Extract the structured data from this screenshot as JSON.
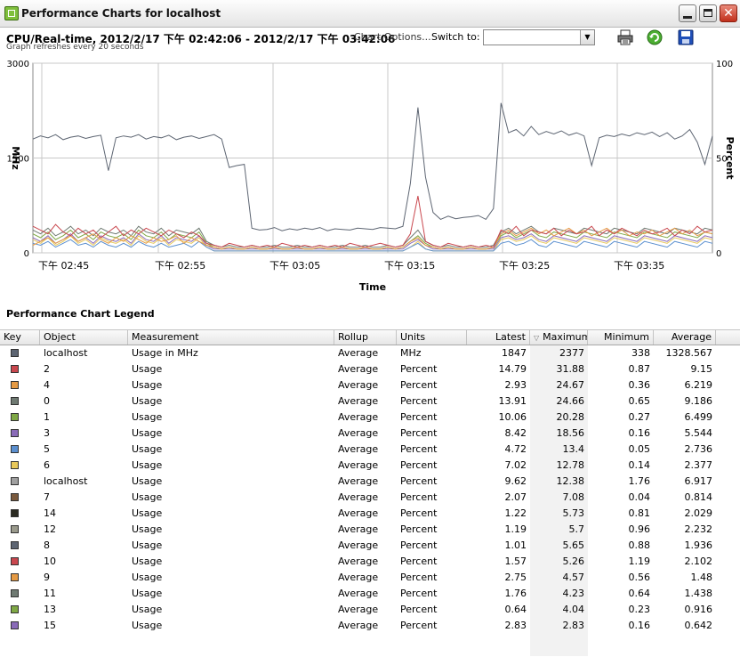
{
  "window": {
    "title": "Performance Charts for localhost"
  },
  "toolbar": {
    "chart_title": "CPU/Real-time, 2012/2/17 下午 02:42:06 - 2012/2/17 下午 03:42:06",
    "chart_options": "Chart Options...",
    "switch_label": "Switch to:",
    "switch_value": "",
    "refresh_note": "Graph refreshes every 20 seconds"
  },
  "chart_data": {
    "type": "line",
    "xlabel": "Time",
    "ylabel_left": "MHz",
    "ylabel_right": "Percent",
    "ylim_left": [
      0,
      3000
    ],
    "ylim_right": [
      0,
      100
    ],
    "yticks_left": [
      "3000",
      "1500",
      "0"
    ],
    "yticks_right": [
      "100",
      "50",
      "0"
    ],
    "xticks": [
      "下午 02:45",
      "下午 02:55",
      "下午 03:05",
      "下午 03:15",
      "下午 03:25",
      "下午 03:35"
    ],
    "grid": true,
    "series": [
      {
        "values": [
          1800,
          1850,
          1820,
          1870,
          1790,
          1830,
          1850,
          1810,
          1840,
          1860,
          1300,
          1820,
          1850,
          1830,
          1870,
          1800,
          1840,
          1820,
          1860,
          1790,
          1830,
          1850,
          1810,
          1840,
          1870,
          1800,
          1350,
          1380,
          1400,
          390,
          360,
          370,
          400,
          350,
          380,
          360,
          390,
          370,
          400,
          350,
          380,
          370,
          360,
          390,
          380,
          370,
          400,
          390,
          380,
          420,
          1100,
          2300,
          1200,
          640,
          530,
          580,
          540,
          560,
          570,
          590,
          530,
          700,
          2370,
          1900,
          1950,
          1850,
          2000,
          1870,
          1920,
          1880,
          1930,
          1860,
          1900,
          1850,
          1380,
          1820,
          1860,
          1840,
          1880,
          1850,
          1900,
          1870,
          1910,
          1840,
          1900,
          1800,
          1850,
          1950,
          1750,
          1400,
          1850
        ],
        "color": "#5d6572"
      },
      {
        "values": [
          14,
          12,
          10,
          15,
          11,
          9,
          13,
          10,
          12,
          8,
          11,
          14,
          9,
          12,
          10,
          13,
          11,
          9,
          12,
          10,
          8,
          11,
          9,
          5,
          4,
          3,
          5,
          4,
          3,
          4,
          3,
          4,
          3,
          5,
          4,
          3,
          4,
          3,
          4,
          3,
          4,
          3,
          5,
          4,
          3,
          4,
          5,
          4,
          3,
          4,
          10,
          30,
          6,
          4,
          3,
          5,
          4,
          3,
          4,
          3,
          4,
          3,
          12,
          10,
          14,
          9,
          12,
          11,
          10,
          13,
          9,
          12,
          10,
          11,
          14,
          9,
          12,
          10,
          13,
          11,
          9,
          12,
          10,
          11,
          13,
          9,
          12,
          10,
          14,
          11,
          12
        ],
        "color": "#c9474e"
      },
      {
        "values": [
          4,
          6,
          8,
          5,
          7,
          9,
          6,
          8,
          10,
          7,
          5,
          8,
          6,
          9,
          7,
          5,
          8,
          6,
          7,
          9,
          5,
          8,
          6,
          4,
          3,
          2,
          3,
          2,
          2,
          3,
          2,
          2,
          3,
          2,
          2,
          3,
          2,
          2,
          3,
          2,
          2,
          3,
          2,
          2,
          3,
          2,
          2,
          3,
          2,
          3,
          6,
          8,
          4,
          3,
          2,
          3,
          2,
          2,
          3,
          2,
          2,
          3,
          10,
          12,
          9,
          11,
          13,
          10,
          12,
          9,
          11,
          13,
          10,
          12,
          9,
          11,
          13,
          10,
          12,
          9,
          11,
          10,
          12,
          9,
          11,
          13,
          10,
          12,
          9,
          11,
          10
        ],
        "color": "#e59a44"
      },
      {
        "values": [
          12,
          10,
          13,
          9,
          11,
          14,
          10,
          12,
          9,
          13,
          11,
          10,
          12,
          9,
          14,
          11,
          10,
          13,
          9,
          12,
          11,
          10,
          13,
          6,
          4,
          3,
          4,
          3,
          3,
          4,
          3,
          3,
          4,
          3,
          3,
          4,
          3,
          3,
          4,
          3,
          3,
          4,
          3,
          3,
          4,
          3,
          3,
          4,
          3,
          4,
          8,
          12,
          6,
          4,
          3,
          4,
          3,
          3,
          4,
          3,
          3,
          4,
          11,
          13,
          10,
          12,
          14,
          11,
          10,
          13,
          12,
          11,
          10,
          13,
          12,
          11,
          10,
          13,
          12,
          11,
          10,
          13,
          12,
          11,
          10,
          13,
          12,
          11,
          10,
          13,
          12
        ],
        "color": "#6f7a72"
      },
      {
        "values": [
          10,
          8,
          11,
          7,
          9,
          12,
          8,
          10,
          7,
          11,
          9,
          8,
          10,
          7,
          12,
          9,
          8,
          11,
          7,
          10,
          9,
          8,
          11,
          5,
          3,
          2,
          3,
          2,
          2,
          3,
          2,
          2,
          3,
          2,
          2,
          3,
          2,
          2,
          3,
          2,
          2,
          3,
          2,
          2,
          3,
          2,
          2,
          3,
          2,
          3,
          6,
          9,
          5,
          3,
          2,
          3,
          2,
          2,
          3,
          2,
          2,
          3,
          9,
          11,
          8,
          10,
          12,
          9,
          8,
          11,
          10,
          9,
          8,
          11,
          10,
          9,
          8,
          11,
          10,
          9,
          8,
          11,
          10,
          9,
          8,
          11,
          10,
          9,
          8,
          11,
          10
        ],
        "color": "#7fa845"
      },
      {
        "values": [
          8,
          6,
          9,
          5,
          7,
          10,
          6,
          8,
          5,
          9,
          7,
          6,
          8,
          5,
          10,
          7,
          6,
          9,
          5,
          8,
          7,
          6,
          9,
          4,
          2,
          2,
          2,
          2,
          2,
          2,
          2,
          2,
          2,
          2,
          2,
          2,
          2,
          2,
          2,
          2,
          2,
          2,
          2,
          2,
          2,
          2,
          2,
          2,
          2,
          2,
          5,
          7,
          4,
          2,
          2,
          2,
          2,
          2,
          2,
          2,
          2,
          2,
          8,
          9,
          7,
          8,
          10,
          7,
          6,
          9,
          8,
          7,
          6,
          9,
          8,
          7,
          6,
          9,
          8,
          7,
          6,
          9,
          8,
          7,
          6,
          9,
          8,
          7,
          6,
          9,
          8
        ],
        "color": "#8a6bb8"
      },
      {
        "values": [
          5,
          4,
          6,
          3,
          5,
          7,
          4,
          5,
          3,
          6,
          4,
          3,
          5,
          3,
          6,
          4,
          3,
          5,
          3,
          4,
          5,
          3,
          6,
          3,
          1,
          1,
          1,
          1,
          1,
          1,
          1,
          1,
          1,
          1,
          1,
          1,
          1,
          1,
          1,
          1,
          1,
          1,
          1,
          1,
          1,
          1,
          1,
          1,
          1,
          1,
          3,
          5,
          2,
          1,
          1,
          1,
          1,
          1,
          1,
          1,
          1,
          1,
          5,
          6,
          4,
          5,
          7,
          4,
          3,
          6,
          5,
          4,
          3,
          6,
          5,
          4,
          3,
          6,
          5,
          4,
          3,
          6,
          5,
          4,
          3,
          6,
          5,
          4,
          3,
          6,
          5
        ],
        "color": "#5b8fcf"
      },
      {
        "values": [
          7,
          5,
          8,
          4,
          6,
          9,
          5,
          7,
          4,
          8,
          6,
          5,
          7,
          4,
          9,
          6,
          5,
          8,
          4,
          7,
          6,
          5,
          8,
          3,
          1,
          1,
          1,
          1,
          1,
          1,
          1,
          1,
          1,
          1,
          1,
          1,
          1,
          1,
          1,
          1,
          1,
          1,
          1,
          1,
          1,
          1,
          1,
          1,
          1,
          1,
          3,
          6,
          2,
          1,
          1,
          1,
          1,
          1,
          1,
          1,
          1,
          1,
          7,
          8,
          6,
          7,
          9,
          6,
          5,
          8,
          7,
          6,
          5,
          8,
          7,
          6,
          5,
          8,
          7,
          6,
          5,
          8,
          7,
          6,
          5,
          8,
          7,
          6,
          5,
          8,
          7
        ],
        "color": "#e8c85a"
      }
    ]
  },
  "legend": {
    "title": "Performance Chart Legend",
    "columns": [
      "Key",
      "Object",
      "Measurement",
      "Rollup",
      "Units",
      "Latest",
      "Maximum",
      "Minimum",
      "Average"
    ],
    "rows": [
      {
        "color": "#5d6572",
        "object": "localhost",
        "measurement": "Usage in MHz",
        "rollup": "Average",
        "units": "MHz",
        "latest": "1847",
        "maximum": "2377",
        "minimum": "338",
        "average": "1328.567"
      },
      {
        "color": "#c9474e",
        "object": "2",
        "measurement": "Usage",
        "rollup": "Average",
        "units": "Percent",
        "latest": "14.79",
        "maximum": "31.88",
        "minimum": "0.87",
        "average": "9.15"
      },
      {
        "color": "#e59a44",
        "object": "4",
        "measurement": "Usage",
        "rollup": "Average",
        "units": "Percent",
        "latest": "2.93",
        "maximum": "24.67",
        "minimum": "0.36",
        "average": "6.219"
      },
      {
        "color": "#6f7a72",
        "object": "0",
        "measurement": "Usage",
        "rollup": "Average",
        "units": "Percent",
        "latest": "13.91",
        "maximum": "24.66",
        "minimum": "0.65",
        "average": "9.186"
      },
      {
        "color": "#7fa845",
        "object": "1",
        "measurement": "Usage",
        "rollup": "Average",
        "units": "Percent",
        "latest": "10.06",
        "maximum": "20.28",
        "minimum": "0.27",
        "average": "6.499"
      },
      {
        "color": "#8a6bb8",
        "object": "3",
        "measurement": "Usage",
        "rollup": "Average",
        "units": "Percent",
        "latest": "8.42",
        "maximum": "18.56",
        "minimum": "0.16",
        "average": "5.544"
      },
      {
        "color": "#5b8fcf",
        "object": "5",
        "measurement": "Usage",
        "rollup": "Average",
        "units": "Percent",
        "latest": "4.72",
        "maximum": "13.4",
        "minimum": "0.05",
        "average": "2.736"
      },
      {
        "color": "#e8c85a",
        "object": "6",
        "measurement": "Usage",
        "rollup": "Average",
        "units": "Percent",
        "latest": "7.02",
        "maximum": "12.78",
        "minimum": "0.14",
        "average": "2.377"
      },
      {
        "color": "#a0a0a0",
        "object": "localhost",
        "measurement": "Usage",
        "rollup": "Average",
        "units": "Percent",
        "latest": "9.62",
        "maximum": "12.38",
        "minimum": "1.76",
        "average": "6.917"
      },
      {
        "color": "#7a5a3e",
        "object": "7",
        "measurement": "Usage",
        "rollup": "Average",
        "units": "Percent",
        "latest": "2.07",
        "maximum": "7.08",
        "minimum": "0.04",
        "average": "0.814"
      },
      {
        "color": "#2b2b22",
        "object": "14",
        "measurement": "Usage",
        "rollup": "Average",
        "units": "Percent",
        "latest": "1.22",
        "maximum": "5.73",
        "minimum": "0.81",
        "average": "2.029"
      },
      {
        "color": "#9a9a8c",
        "object": "12",
        "measurement": "Usage",
        "rollup": "Average",
        "units": "Percent",
        "latest": "1.19",
        "maximum": "5.7",
        "minimum": "0.96",
        "average": "2.232"
      },
      {
        "color": "#5d6572",
        "object": "8",
        "measurement": "Usage",
        "rollup": "Average",
        "units": "Percent",
        "latest": "1.01",
        "maximum": "5.65",
        "minimum": "0.88",
        "average": "1.936"
      },
      {
        "color": "#c9474e",
        "object": "10",
        "measurement": "Usage",
        "rollup": "Average",
        "units": "Percent",
        "latest": "1.57",
        "maximum": "5.26",
        "minimum": "1.19",
        "average": "2.102"
      },
      {
        "color": "#e59a44",
        "object": "9",
        "measurement": "Usage",
        "rollup": "Average",
        "units": "Percent",
        "latest": "2.75",
        "maximum": "4.57",
        "minimum": "0.56",
        "average": "1.48"
      },
      {
        "color": "#6f7a72",
        "object": "11",
        "measurement": "Usage",
        "rollup": "Average",
        "units": "Percent",
        "latest": "1.76",
        "maximum": "4.23",
        "minimum": "0.64",
        "average": "1.438"
      },
      {
        "color": "#7fa845",
        "object": "13",
        "measurement": "Usage",
        "rollup": "Average",
        "units": "Percent",
        "latest": "0.64",
        "maximum": "4.04",
        "minimum": "0.23",
        "average": "0.916"
      },
      {
        "color": "#8a6bb8",
        "object": "15",
        "measurement": "Usage",
        "rollup": "Average",
        "units": "Percent",
        "latest": "2.83",
        "maximum": "2.83",
        "minimum": "0.16",
        "average": "0.642"
      }
    ]
  }
}
